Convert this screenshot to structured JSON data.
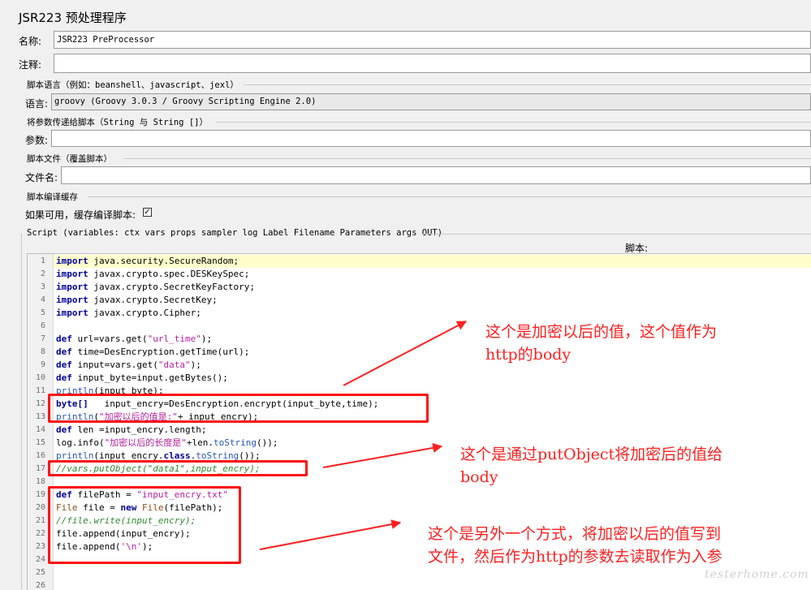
{
  "panel": {
    "title": "JSR223 预处理程序",
    "name_label": "名称:",
    "name_value": "JSR223 PreProcessor",
    "comment_label": "注释:",
    "comment_value": ""
  },
  "language_group": {
    "title": "脚本语言（例如：beanshell、javascript、jexl）",
    "label": "语言:",
    "value": "groovy     (Groovy 3.0.3 / Groovy Scripting Engine 2.0)"
  },
  "params_group": {
    "title": "将参数传递给脚本（String 与 String []）",
    "label": "参数:",
    "value": ""
  },
  "file_group": {
    "title": "脚本文件（覆盖脚本）",
    "label": "文件名:",
    "value": ""
  },
  "cache_group": {
    "title": "脚本编译缓存",
    "label": "如果可用，缓存编译脚本:",
    "checked": true,
    "check_glyph": "✓"
  },
  "script_group": {
    "title": "Script (variables: ctx vars props sampler log Label Filename Parameters args OUT)",
    "script_label": "脚本:"
  },
  "editor": {
    "line_numbers": [
      "1",
      "2",
      "3",
      "4",
      "5",
      "6",
      "7",
      "8",
      "9",
      "10",
      "11",
      "12",
      "13",
      "14",
      "15",
      "16",
      "17",
      "18",
      "19",
      "20",
      "21",
      "22",
      "23",
      "24",
      "25",
      "26"
    ],
    "lines": [
      [
        {
          "t": "import",
          "c": "kw"
        },
        {
          "t": " java.security.SecureRandom;",
          "c": ""
        }
      ],
      [
        {
          "t": "import",
          "c": "kw"
        },
        {
          "t": " javax.crypto.spec.DESKeySpec;",
          "c": ""
        }
      ],
      [
        {
          "t": "import",
          "c": "kw"
        },
        {
          "t": " javax.crypto.SecretKeyFactory;",
          "c": ""
        }
      ],
      [
        {
          "t": "import",
          "c": "kw"
        },
        {
          "t": " javax.crypto.SecretKey;",
          "c": ""
        }
      ],
      [
        {
          "t": "import",
          "c": "kw"
        },
        {
          "t": " javax.crypto.Cipher;",
          "c": ""
        }
      ],
      [],
      [
        {
          "t": "def",
          "c": "kw"
        },
        {
          "t": " url=vars.get(",
          "c": ""
        },
        {
          "t": "\"url_time\"",
          "c": "str"
        },
        {
          "t": ");",
          "c": ""
        }
      ],
      [
        {
          "t": "def",
          "c": "kw"
        },
        {
          "t": " time=DesEncryption.getTime(url);",
          "c": ""
        }
      ],
      [
        {
          "t": "def",
          "c": "kw"
        },
        {
          "t": " input=vars.get(",
          "c": ""
        },
        {
          "t": "\"data\"",
          "c": "str"
        },
        {
          "t": ");",
          "c": ""
        }
      ],
      [
        {
          "t": "def",
          "c": "kw"
        },
        {
          "t": " input_byte=input.getBytes();",
          "c": ""
        }
      ],
      [
        {
          "t": "println",
          "c": "mth"
        },
        {
          "t": "(input_byte);",
          "c": ""
        }
      ],
      [
        {
          "t": "byte[]",
          "c": "kw"
        },
        {
          "t": "   input_encry=DesEncryption.encrypt(input_byte,time);",
          "c": ""
        }
      ],
      [
        {
          "t": "println",
          "c": "mth"
        },
        {
          "t": "(",
          "c": ""
        },
        {
          "t": "\"加密以后的值是:\"",
          "c": "str"
        },
        {
          "t": "+ input_encry);",
          "c": ""
        }
      ],
      [
        {
          "t": "def",
          "c": "kw"
        },
        {
          "t": " len =input_encry.length;",
          "c": ""
        }
      ],
      [
        {
          "t": "log.info(",
          "c": ""
        },
        {
          "t": "\"加密以后的长度是\"",
          "c": "str"
        },
        {
          "t": "+len.",
          "c": ""
        },
        {
          "t": "toString",
          "c": "mth"
        },
        {
          "t": "());",
          "c": ""
        }
      ],
      [
        {
          "t": "println",
          "c": "mth"
        },
        {
          "t": "(input_encry.",
          "c": ""
        },
        {
          "t": "class",
          "c": "kw"
        },
        {
          "t": ".",
          "c": ""
        },
        {
          "t": "toString",
          "c": "mth"
        },
        {
          "t": "());",
          "c": ""
        }
      ],
      [
        {
          "t": "//vars.putObject(\"data1\",input_encry);",
          "c": "cmt"
        }
      ],
      [],
      [
        {
          "t": "def",
          "c": "kw"
        },
        {
          "t": " filePath = ",
          "c": ""
        },
        {
          "t": "\"input_encry.txt\"",
          "c": "str"
        }
      ],
      [
        {
          "t": "File",
          "c": "ty"
        },
        {
          "t": " file = ",
          "c": ""
        },
        {
          "t": "new",
          "c": "kw"
        },
        {
          "t": " ",
          "c": ""
        },
        {
          "t": "File",
          "c": "ty"
        },
        {
          "t": "(filePath);",
          "c": ""
        }
      ],
      [
        {
          "t": "//file.write(input_encry);",
          "c": "cmt"
        }
      ],
      [
        {
          "t": "file.append(input_encry);",
          "c": ""
        }
      ],
      [
        {
          "t": "file.append(",
          "c": ""
        },
        {
          "t": "'\\n'",
          "c": "str"
        },
        {
          "t": ");",
          "c": ""
        }
      ],
      [],
      [],
      []
    ]
  },
  "annotations": [
    {
      "line1": "这个是加密以后的值，这个值作为",
      "line2": "http的body"
    },
    {
      "line1": "这个是通过putObject将加密后的值给",
      "line2": "body"
    },
    {
      "line1": "这个是另外一个方式，将加密以后的值写到",
      "line2": "文件，然后作为http的参数去读取作为入参"
    }
  ],
  "colors": {
    "annotation_red": "#ff1f1f",
    "keyword": "#00009c",
    "string": "#b31e9e",
    "comment": "#2f8a2f",
    "current_line": "#ffffcc"
  },
  "watermark": "testerhome.com"
}
